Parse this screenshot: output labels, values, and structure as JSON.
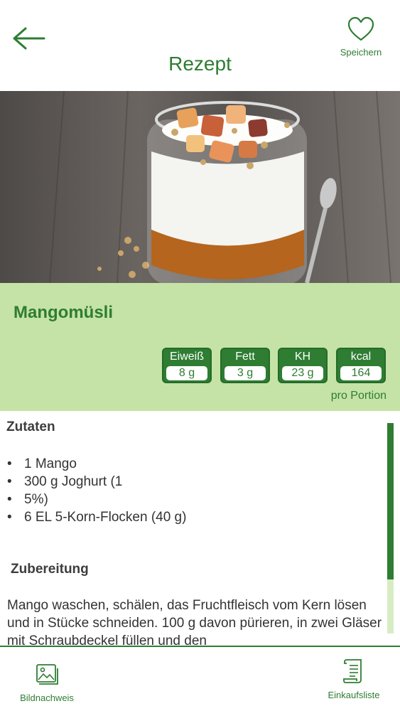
{
  "header": {
    "title": "Rezept",
    "save_label": "Speichern"
  },
  "recipe": {
    "name": "Mangomüsli",
    "nutrition": [
      {
        "label": "Eiweiß",
        "value": "8 g"
      },
      {
        "label": "Fett",
        "value": "3 g"
      },
      {
        "label": "KH",
        "value": "23 g"
      },
      {
        "label": "kcal",
        "value": "164"
      }
    ],
    "per_portion": "pro Portion"
  },
  "ingredients": {
    "heading": "Zutaten",
    "items": [
      "1 Mango",
      "300 g Joghurt (1",
      "5%)",
      "6 EL 5-Korn-Flocken (40 g)"
    ]
  },
  "preparation": {
    "heading": "Zubereitung",
    "text": "Mango waschen, schälen, das Fruchtfleisch vom Kern lösen und in Stücke schneiden. 100 g davon pürieren, in zwei Gläser mit Schraubdeckel füllen und den"
  },
  "bottom_bar": {
    "image_credits": "Bildnachweis",
    "shopping_list": "Einkaufsliste"
  },
  "colors": {
    "accent": "#2e7d32",
    "panel": "#c5e3a6"
  }
}
